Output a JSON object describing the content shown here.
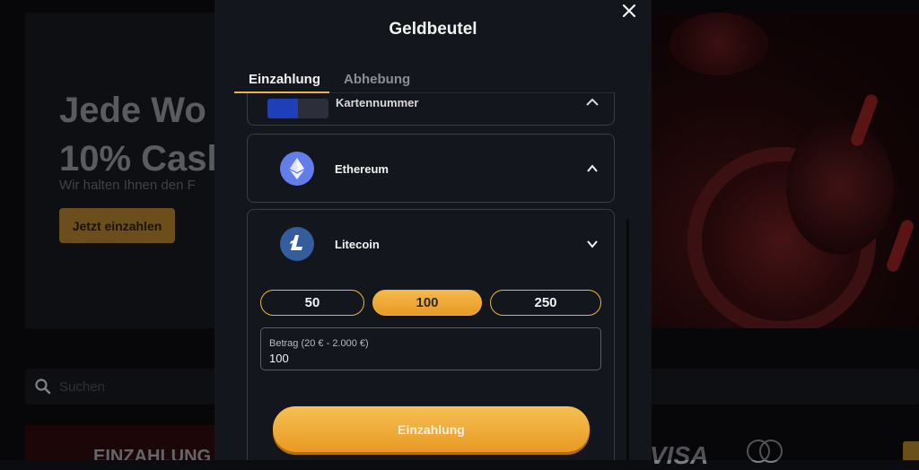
{
  "background": {
    "hero": {
      "title_line1": "Jede Wo",
      "title_line2": "10% Casl",
      "subtitle": "Wir halten Ihnen den F",
      "cta_label": "Jetzt einzahlen"
    },
    "search": {
      "placeholder": "Suchen",
      "icon": "search-icon"
    },
    "banner": {
      "text": "EINZAHLUNG"
    },
    "payment_logos": {
      "visa": "VISA",
      "mastercard": "mastercard-icon"
    }
  },
  "modal": {
    "title": "Geldbeutel",
    "close_icon": "close-icon",
    "tabs": [
      {
        "label": "Einzahlung",
        "active": true
      },
      {
        "label": "Abhebung",
        "active": false
      }
    ],
    "methods": [
      {
        "label": "Kartennummer",
        "icon": "visa-mastercard-icon",
        "state": "partially-visible"
      },
      {
        "label": "Ethereum",
        "icon": "ethereum-icon",
        "chevron": "chevron-up-icon"
      },
      {
        "label": "Litecoin",
        "icon": "litecoin-icon",
        "chevron": "chevron-down-icon",
        "expanded": true
      }
    ],
    "amount_options": [
      "50",
      "100",
      "250"
    ],
    "selected_amount": "100",
    "amount_field": {
      "label": "Betrag (20 € - 2.000 €)",
      "value": "100"
    },
    "submit_label": "Einzahlung"
  },
  "colors": {
    "accent": "#f0b23a",
    "modal_bg": "#14161d",
    "ethereum": "#627eea",
    "litecoin": "#345d9d"
  }
}
